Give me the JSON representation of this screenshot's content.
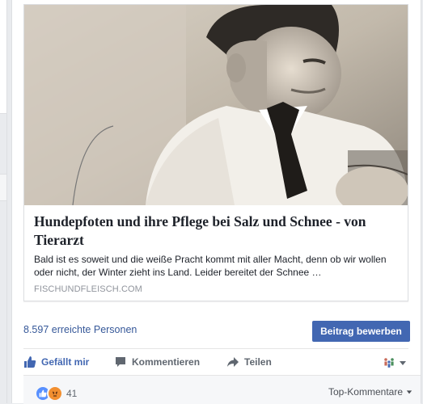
{
  "post": {
    "link": {
      "title": "Hundepfoten und ihre Pflege bei Salz und Schnee - von Tierarzt",
      "description": "Bald ist es soweit und die weiße Pracht kommt mit aller Macht, denn ob wir wollen oder nicht, der Winter zieht ins Land. Leider bereitet der Schnee …",
      "domain": "FISCHUNDFLEISCH.COM"
    },
    "reach_text": "8.597 erreichte Personen",
    "boost_label": "Beitrag bewerben"
  },
  "actions": {
    "like": "Gefällt mir",
    "comment": "Kommentieren",
    "share": "Teilen"
  },
  "footer": {
    "reaction_count": "41",
    "sort_label": "Top-Kommentare"
  },
  "colors": {
    "facebook_blue": "#4267b2",
    "link_blue": "#365899",
    "background": "#e9ebee"
  },
  "icons": {
    "like": "thumbs-up-icon",
    "comment": "comment-icon",
    "share": "share-arrow-icon",
    "audience": "friends-icon",
    "dropdown": "caret-down-icon"
  }
}
